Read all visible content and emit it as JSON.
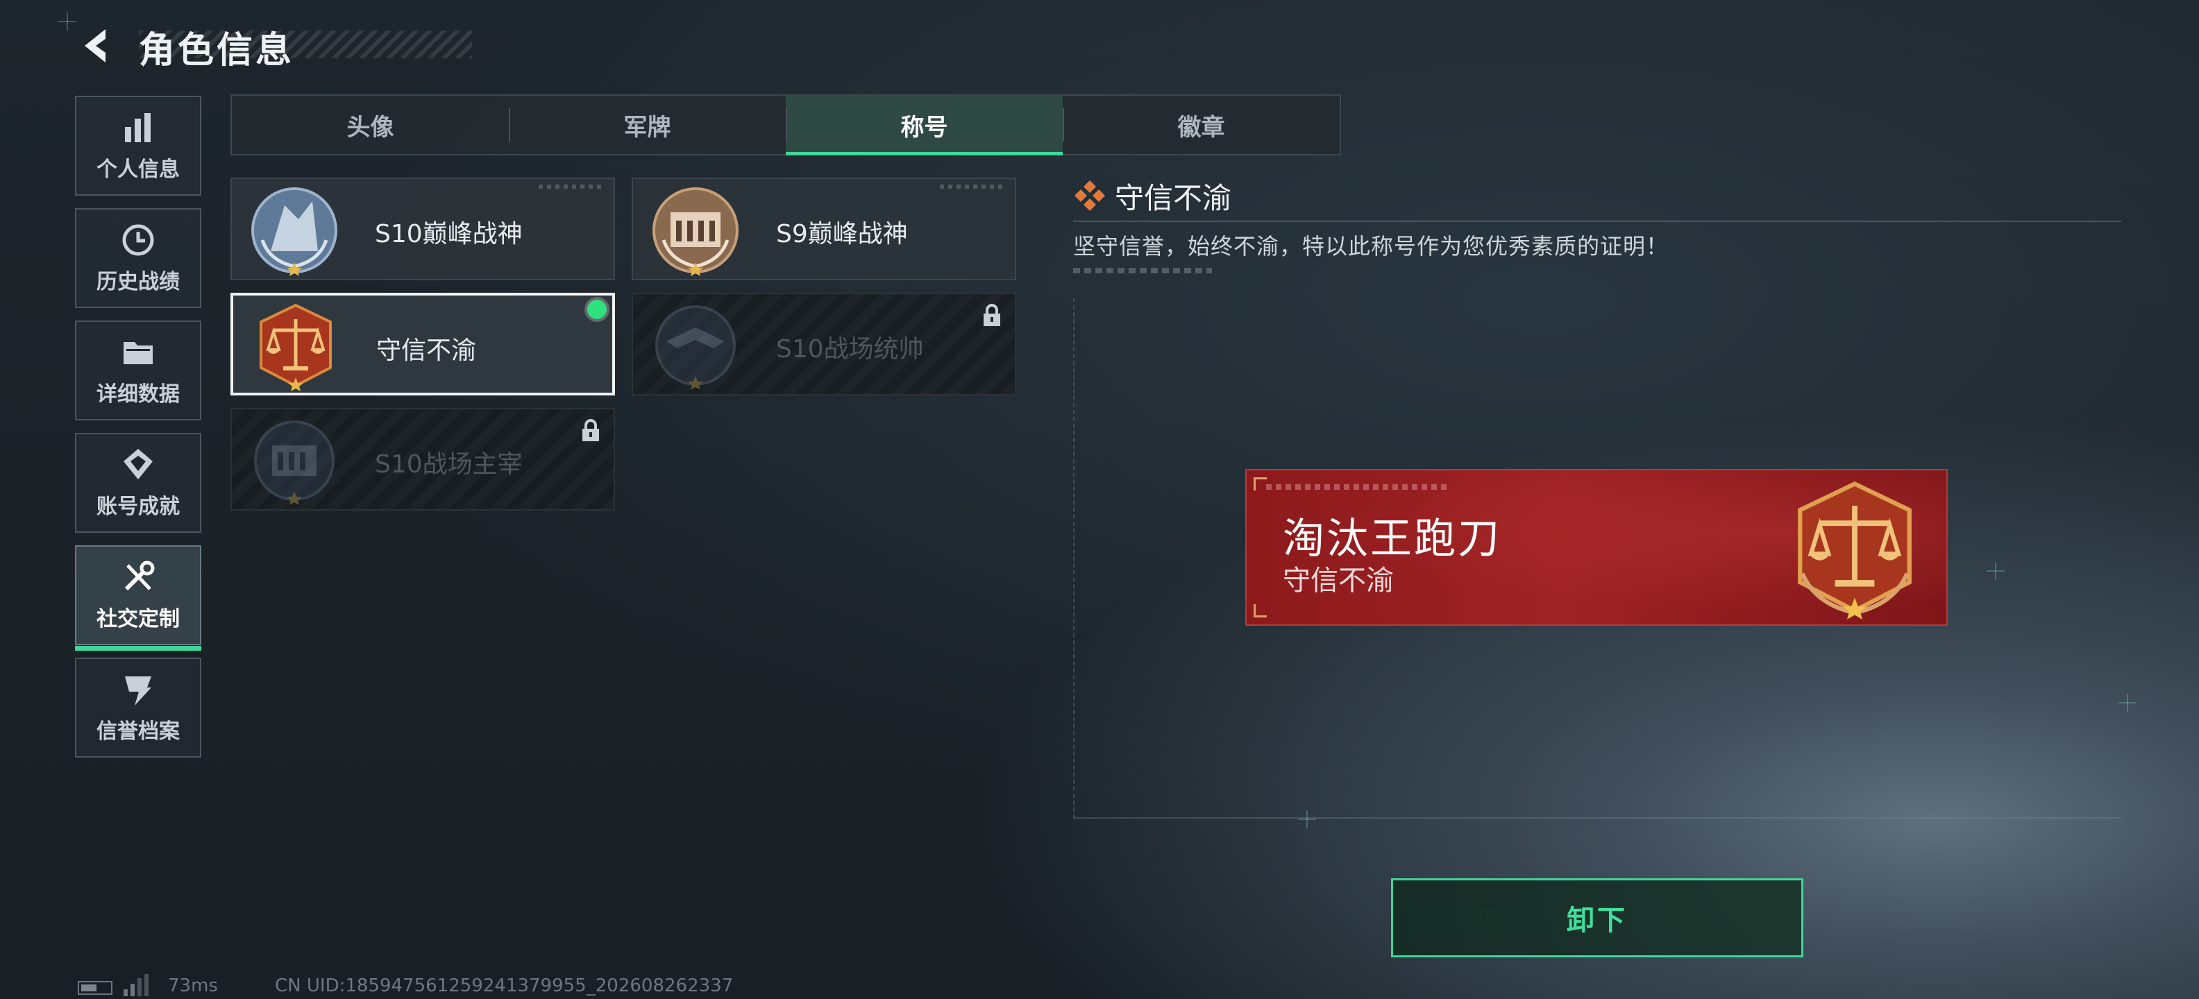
{
  "header": {
    "title": "角色信息",
    "back_icon": "back-arrow-icon"
  },
  "sidebar": {
    "items": [
      {
        "label": "个人信息",
        "icon": "bar-chart-icon",
        "active": false
      },
      {
        "label": "历史战绩",
        "icon": "history-clock-icon",
        "active": false
      },
      {
        "label": "详细数据",
        "icon": "folder-icon",
        "active": false
      },
      {
        "label": "账号成就",
        "icon": "achievement-icon",
        "active": false
      },
      {
        "label": "社交定制",
        "icon": "tools-icon",
        "active": true
      },
      {
        "label": "信誉档案",
        "icon": "credit-badge-icon",
        "active": false
      }
    ]
  },
  "tabs": [
    {
      "label": "头像",
      "active": false
    },
    {
      "label": "军牌",
      "active": false
    },
    {
      "label": "称号",
      "active": true
    },
    {
      "label": "徽章",
      "active": false
    }
  ],
  "titles": [
    {
      "name": "S10巅峰战神",
      "locked": false,
      "selected": false,
      "equipped": false,
      "badge_icon": "s10-peak-badge-icon"
    },
    {
      "name": "S9巅峰战神",
      "locked": false,
      "selected": false,
      "equipped": false,
      "badge_icon": "s9-peak-badge-icon"
    },
    {
      "name": "守信不渝",
      "locked": false,
      "selected": true,
      "equipped": true,
      "badge_icon": "scales-badge-icon"
    },
    {
      "name": "S10战场统帅",
      "locked": true,
      "selected": false,
      "equipped": false,
      "badge_icon": "s10-commander-badge-icon"
    },
    {
      "name": "S10战场主宰",
      "locked": true,
      "selected": false,
      "equipped": false,
      "badge_icon": "s10-ruler-badge-icon"
    }
  ],
  "detail": {
    "title": "守信不渝",
    "description": "坚守信誉，始终不渝，特以此称号作为您优秀素质的证明！",
    "icon": "diamond-cluster-icon"
  },
  "nameplate": {
    "player_name": "淘汰王跑刀",
    "title": "守信不渝",
    "emblem_icon": "scales-badge-icon",
    "color": "#9f2224"
  },
  "actions": {
    "unequip_label": "卸下"
  },
  "status": {
    "ping": "73ms",
    "uid": "CN UID:1859475612592413799​55_202608262337"
  },
  "colors": {
    "accent": "#3fd69a",
    "equipped_dot": "#2fe07d",
    "plate_red": "#9f2224"
  }
}
